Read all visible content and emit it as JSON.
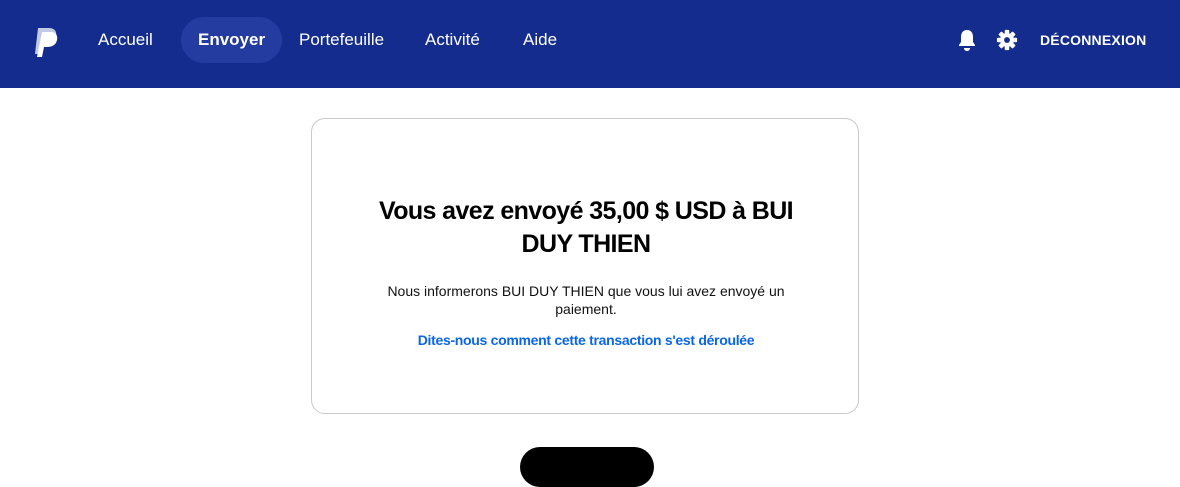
{
  "header": {
    "logo_icon": "paypal-logo",
    "nav": [
      {
        "label": "Accueil"
      },
      {
        "label": "Envoyer"
      },
      {
        "label": "Portefeuille"
      },
      {
        "label": "Activité"
      },
      {
        "label": "Aide"
      }
    ],
    "active_nav": "Envoyer",
    "notifications_icon": "bell-icon",
    "settings_icon": "gear-icon",
    "logout_label": "DÉCONNEXION",
    "bg_color": "#142c8e"
  },
  "confirmation": {
    "title_line1": "Vous avez envoyé 35,00 $ USD à BUI",
    "title_line2": "DUY THIEN",
    "message_line1": "Nous informerons BUI DUY THIEN que vous lui avez envoyé un",
    "message_line2": "paiement.",
    "feedback_link": "Dites-nous comment cette transaction s'est déroulée",
    "link_color": "#0a66e6"
  }
}
